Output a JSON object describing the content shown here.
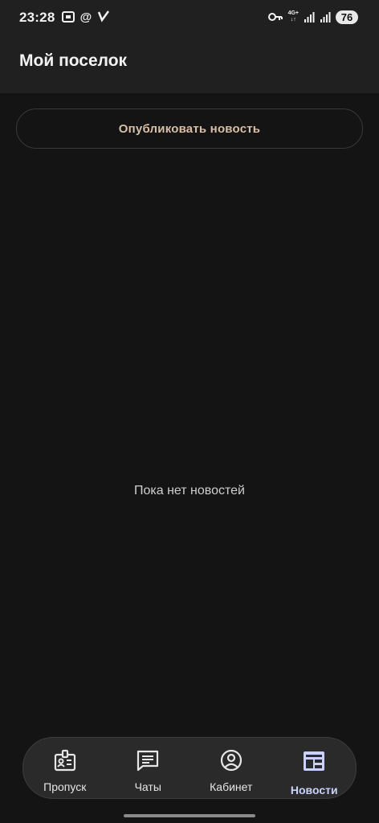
{
  "status_bar": {
    "time": "23:28",
    "left_icons": [
      "screenshot-icon",
      "at-icon",
      "check-icon"
    ],
    "network_label": "4G+",
    "battery": "76"
  },
  "app_bar": {
    "title": "Мой поселок"
  },
  "main": {
    "publish_button_label": "Опубликовать новость",
    "empty_message": "Пока нет новостей"
  },
  "bottom_nav": {
    "items": [
      {
        "label": "Пропуск",
        "icon": "badge-icon"
      },
      {
        "label": "Чаты",
        "icon": "chat-icon"
      },
      {
        "label": "Кабинет",
        "icon": "profile-icon"
      },
      {
        "label": "Новости",
        "icon": "news-icon",
        "active": true
      }
    ],
    "active_color": "#c9d2ff"
  }
}
